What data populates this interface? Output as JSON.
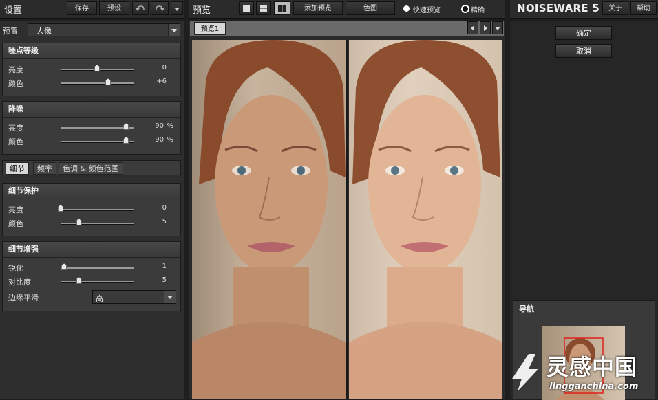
{
  "left_panel": {
    "title": "设置",
    "save_label": "保存",
    "presets_label": "预设",
    "preset_label": "预置",
    "preset_value": "人像",
    "noise_level": {
      "title": "噪点等级",
      "rows": [
        {
          "label": "亮度",
          "value": "0",
          "pos": 0.5
        },
        {
          "label": "颜色",
          "value": "+6",
          "pos": 0.65
        }
      ]
    },
    "noise_reduction": {
      "title": "降噪",
      "rows": [
        {
          "label": "亮度",
          "value": "90",
          "unit": "%",
          "pos": 0.9
        },
        {
          "label": "颜色",
          "value": "90",
          "unit": "%",
          "pos": 0.9
        }
      ]
    },
    "tabs": [
      "细节",
      "频率",
      "色调 & 颜色范围"
    ],
    "detail_protect": {
      "title": "细节保护",
      "rows": [
        {
          "label": "亮度",
          "value": "0",
          "pos": 0.0
        },
        {
          "label": "颜色",
          "value": "5",
          "pos": 0.25
        }
      ]
    },
    "detail_enhance": {
      "title": "细节增强",
      "rows": [
        {
          "label": "锐化",
          "value": "1",
          "pos": 0.05
        },
        {
          "label": "对比度",
          "value": "5",
          "pos": 0.25
        }
      ],
      "edge_label": "边缘平滑",
      "edge_value": "高"
    }
  },
  "center": {
    "title": "预览",
    "add_preview_label": "添加预览",
    "color_label": "色图",
    "fast_preview_label": "快速预览",
    "precise_label": "精确",
    "tab_label": "预览1"
  },
  "right": {
    "logo_text": "NOISEWARE 5",
    "about_label": "关于",
    "help_label": "帮助",
    "ok_label": "确定",
    "cancel_label": "取消",
    "nav_title": "导航"
  },
  "watermark": {
    "cn": "灵感中国",
    "url": "lingganchina.com"
  },
  "colors": {
    "accent_red": "#e0201a",
    "tab_active": "#d8d8d8"
  }
}
